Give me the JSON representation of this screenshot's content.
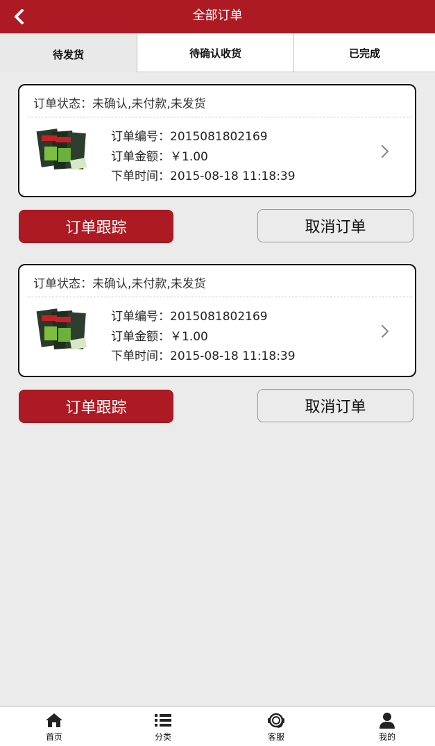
{
  "header": {
    "title": "全部订单",
    "back_icon": "chevron-left-icon"
  },
  "tabs": [
    {
      "label": "待发货",
      "active": true
    },
    {
      "label": "待确认收货",
      "active": false
    },
    {
      "label": "已完成",
      "active": false
    }
  ],
  "orders": [
    {
      "status": "订单状态：未确认,未付款,未发货",
      "number": "订单编号：2015081802169",
      "amount": "订单金额：￥1.00",
      "time": "下单时间：2015-08-18 11:18:39",
      "track_label": "订单跟踪",
      "cancel_label": "取消订单"
    },
    {
      "status": "订单状态：未确认,未付款,未发货",
      "number": "订单编号：2015081802169",
      "amount": "订单金额：￥1.00",
      "time": "下单时间：2015-08-18 11:18:39",
      "track_label": "订单跟踪",
      "cancel_label": "取消订单"
    }
  ],
  "bottom_nav": [
    {
      "label": "首页",
      "icon": "home-icon"
    },
    {
      "label": "分类",
      "icon": "list-icon"
    },
    {
      "label": "客服",
      "icon": "headset-icon"
    },
    {
      "label": "我的",
      "icon": "user-icon"
    }
  ],
  "colors": {
    "brand": "#ad1a23",
    "background": "#ebebeb"
  }
}
